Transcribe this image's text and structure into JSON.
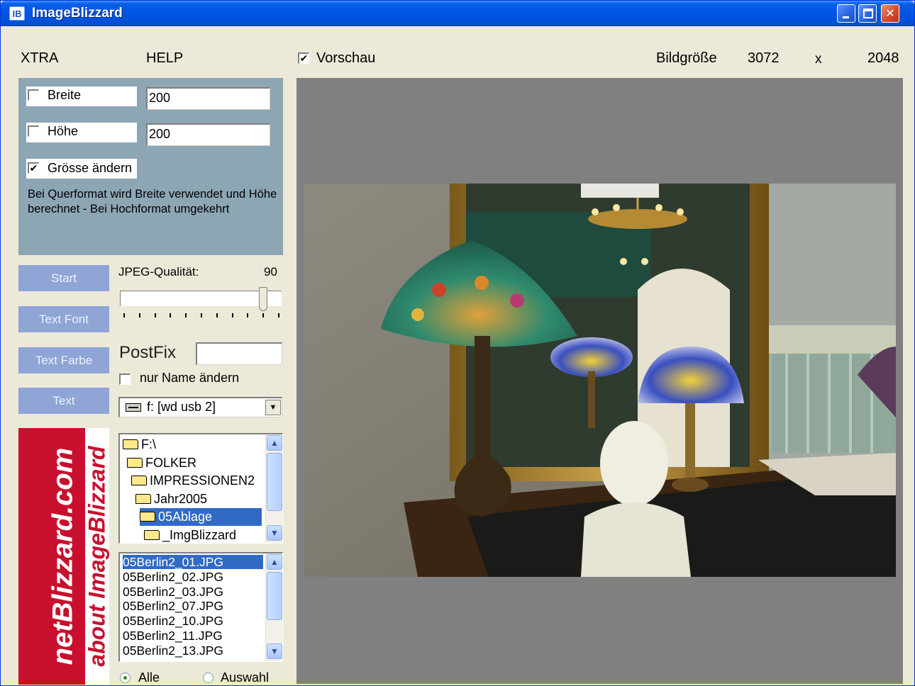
{
  "window": {
    "app_icon": "IB",
    "title": "ImageBlizzard"
  },
  "menu": {
    "xtra": "XTRA",
    "help": "HELP"
  },
  "header": {
    "preview_label": "Vorschau",
    "preview_checked": true,
    "image_size_label": "Bildgröße",
    "width": "3072",
    "times": "x",
    "height": "2048"
  },
  "settings": {
    "width_label": "Breite",
    "width_checked": false,
    "width_value": "200",
    "height_label": "Höhe",
    "height_checked": false,
    "height_value": "200",
    "resize_label": "Grösse ändern",
    "resize_checked": true,
    "help_text": "Bei Querformat wird Breite verwendet und Höhe berechnet - Bei Hochformat umgekehrt"
  },
  "buttons": {
    "start": "Start",
    "text_font": "Text Font",
    "text_color": "Text Farbe",
    "text": "Text"
  },
  "jpeg": {
    "label": "JPEG-Qualität:",
    "value": "90",
    "slider_level": 0.9
  },
  "postfix": {
    "label": "PostFix",
    "value": "",
    "name_only_label": "nur Name ändern",
    "name_only_checked": false
  },
  "drive": {
    "icon": "drive-icon",
    "selected": "f: [wd usb 2]"
  },
  "banner": {
    "main": "netBlizzard.com",
    "sub": "about ImageBlizzard"
  },
  "folders": [
    {
      "label": "F:\\",
      "selected": false
    },
    {
      "label": "FOLKER",
      "selected": false
    },
    {
      "label": "IMPRESSIONEN2",
      "selected": false
    },
    {
      "label": "Jahr2005",
      "selected": false
    },
    {
      "label": "05Ablage",
      "selected": true
    },
    {
      "label": "_ImgBlizzard",
      "selected": false
    }
  ],
  "files": [
    {
      "label": "05Berlin2_01.JPG",
      "selected": true
    },
    {
      "label": "05Berlin2_02.JPG",
      "selected": false
    },
    {
      "label": "05Berlin2_03.JPG",
      "selected": false
    },
    {
      "label": "05Berlin2_07.JPG",
      "selected": false
    },
    {
      "label": "05Berlin2_10.JPG",
      "selected": false
    },
    {
      "label": "05Berlin2_11.JPG",
      "selected": false
    },
    {
      "label": "05Berlin2_13.JPG",
      "selected": false
    }
  ],
  "selection_mode": {
    "all_label": "Alle",
    "selection_label": "Auswahl",
    "selected": "all"
  },
  "colors": {
    "titlebar": "#0054e3",
    "panel": "#8ca6b4",
    "button": "#8fa5d6",
    "banner_red": "#c8102e",
    "preview_bg": "#808080",
    "selection": "#316ac5"
  }
}
